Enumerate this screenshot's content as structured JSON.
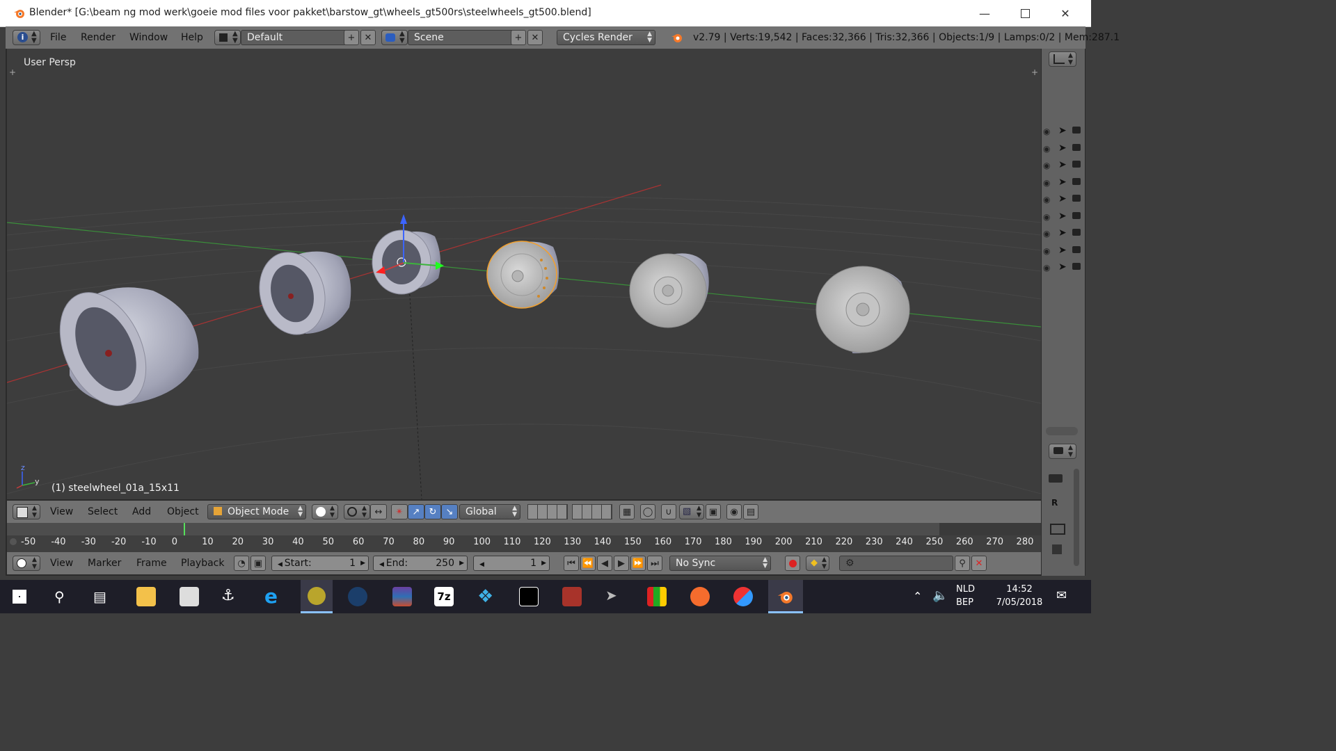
{
  "window": {
    "title": "Blender* [G:\\beam ng mod werk\\goeie mod files voor pakket\\barstow_gt\\wheels_gt500rs\\steelwheels_gt500.blend]"
  },
  "info_header": {
    "menus": [
      "File",
      "Render",
      "Window",
      "Help"
    ],
    "layout": "Default",
    "scene": "Scene",
    "engine": "Cycles Render",
    "stats": "v2.79 | Verts:19,542 | Faces:32,366 | Tris:32,366 | Objects:1/9 | Lamps:0/2 | Mem:287.1"
  },
  "viewport": {
    "view_label": "User Persp",
    "object_label": "(1) steelwheel_01a_15x11",
    "axis_z": "z",
    "axis_y": "y"
  },
  "header_3d": {
    "menus": [
      "View",
      "Select",
      "Add",
      "Object"
    ],
    "mode": "Object Mode",
    "orientation": "Global"
  },
  "timeline": {
    "ticks": [
      "-50",
      "-40",
      "-30",
      "-20",
      "-10",
      "0",
      "10",
      "20",
      "30",
      "40",
      "50",
      "60",
      "70",
      "80",
      "90",
      "100",
      "110",
      "120",
      "130",
      "140",
      "150",
      "160",
      "170",
      "180",
      "190",
      "200",
      "210",
      "220",
      "230",
      "240",
      "250",
      "260",
      "270",
      "280"
    ],
    "menus": [
      "View",
      "Marker",
      "Frame",
      "Playback"
    ],
    "start_label": "Start:",
    "start_value": "1",
    "end_label": "End:",
    "end_value": "250",
    "current_frame": "1",
    "sync": "No Sync"
  },
  "outliner_side": {
    "r_label": "R"
  },
  "taskbar": {
    "lang_top": "NLD",
    "lang_bottom": "BEP",
    "time": "14:52",
    "date": "7/05/2018",
    "app_label_7z": "7z"
  },
  "colors": {
    "accent_blender": "#f5792a",
    "x_axis": "#c83c3c",
    "y_axis": "#3cb43c",
    "z_axis": "#3c64ff",
    "selection": "#f0a030"
  }
}
